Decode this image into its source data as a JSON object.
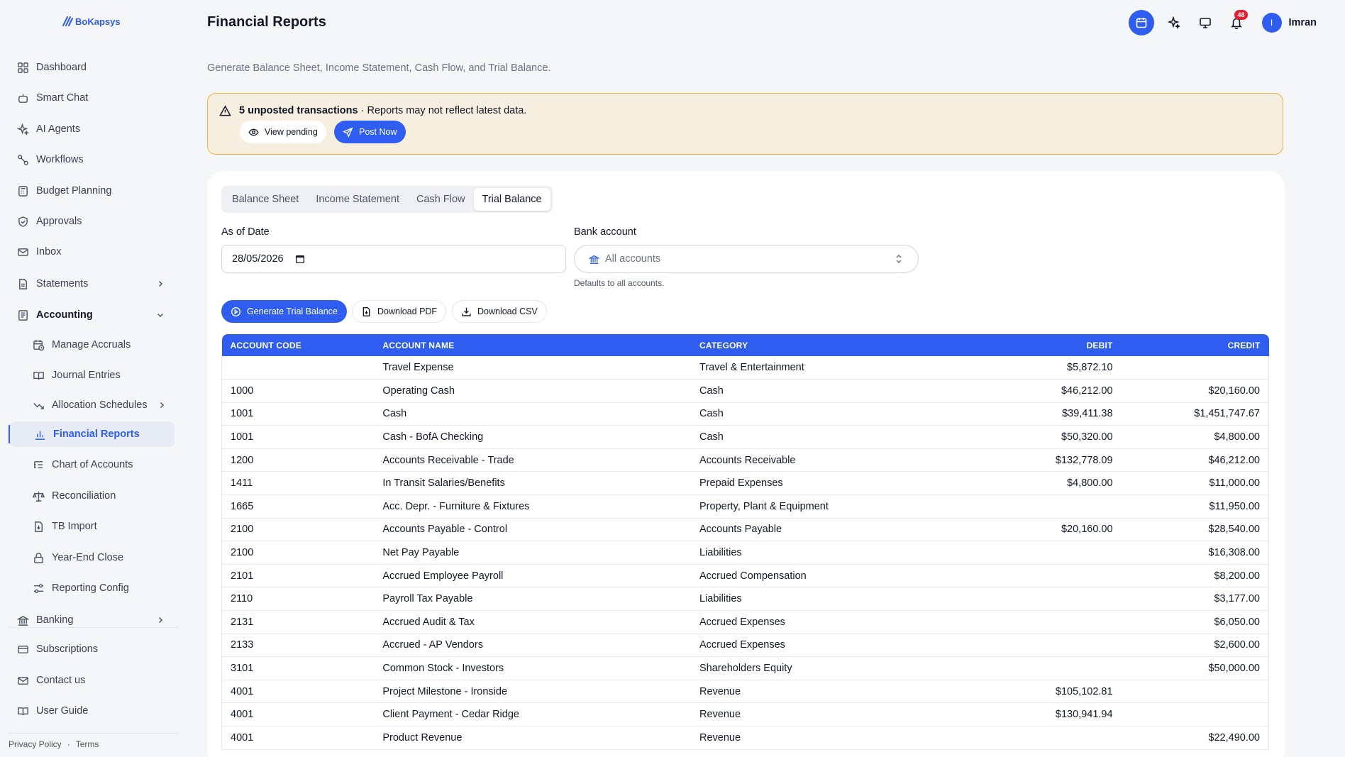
{
  "brand": {
    "name": "BoKapsys"
  },
  "sidebar": {
    "items": [
      {
        "label": "Dashboard",
        "icon": "grid-icon"
      },
      {
        "label": "Smart Chat",
        "icon": "bot-icon"
      },
      {
        "label": "AI Agents",
        "icon": "sparkles-icon"
      },
      {
        "label": "Workflows",
        "icon": "workflow-icon"
      },
      {
        "label": "Budget Planning",
        "icon": "calculator-icon"
      },
      {
        "label": "Approvals",
        "icon": "shield-check-icon"
      },
      {
        "label": "Inbox",
        "icon": "mail-icon"
      },
      {
        "label": "Statements",
        "icon": "file-icon"
      },
      {
        "label": "Accounting",
        "icon": "ledger-icon"
      }
    ],
    "accounting_sub": [
      {
        "label": "Manage Accruals",
        "icon": "calendar-clock-icon"
      },
      {
        "label": "Journal Entries",
        "icon": "book-open-icon"
      },
      {
        "label": "Allocation Schedules",
        "icon": "trend-down-icon"
      },
      {
        "label": "Financial Reports",
        "icon": "bar-chart-icon"
      },
      {
        "label": "Chart of Accounts",
        "icon": "list-tree-icon"
      },
      {
        "label": "Reconciliation",
        "icon": "scale-icon"
      },
      {
        "label": "TB Import",
        "icon": "file-import-icon"
      },
      {
        "label": "Year-End Close",
        "icon": "lock-icon"
      },
      {
        "label": "Reporting Config",
        "icon": "sliders-icon"
      }
    ],
    "bottom": [
      {
        "label": "Banking",
        "icon": "bank-icon"
      },
      {
        "label": "Subscriptions",
        "icon": "credit-card-icon"
      },
      {
        "label": "Contact us",
        "icon": "mail-icon"
      },
      {
        "label": "User Guide",
        "icon": "book-open-icon"
      }
    ],
    "footer": {
      "privacy": "Privacy Policy",
      "sep": "·",
      "terms": "Terms"
    }
  },
  "header": {
    "title": "Financial Reports",
    "subtitle": "Generate Balance Sheet, Income Statement, Cash Flow, and Trial Balance.",
    "notifications_count": "48",
    "user_initial": "I",
    "user_name": "Imran"
  },
  "alert": {
    "count_text": "5 unposted transactions",
    "message": " · Reports may not reflect latest data.",
    "view_label": "View pending",
    "post_label": "Post Now"
  },
  "tabs": [
    "Balance Sheet",
    "Income Statement",
    "Cash Flow",
    "Trial Balance"
  ],
  "active_tab": "Trial Balance",
  "form": {
    "date_label": "As of Date",
    "date_value": "28/05/2026",
    "bank_label": "Bank account",
    "bank_value": "All accounts",
    "bank_hint": "Defaults to all accounts."
  },
  "actions": {
    "generate": "Generate Trial Balance",
    "pdf": "Download PDF",
    "csv": "Download CSV"
  },
  "table": {
    "headers": [
      "ACCOUNT CODE",
      "ACCOUNT NAME",
      "CATEGORY",
      "DEBIT",
      "CREDIT"
    ],
    "rows": [
      [
        "",
        "Travel Expense",
        "Travel & Entertainment",
        "$5,872.10",
        ""
      ],
      [
        "1000",
        "Operating Cash",
        "Cash",
        "$46,212.00",
        "$20,160.00"
      ],
      [
        "1001",
        "Cash",
        "Cash",
        "$39,411.38",
        "$1,451,747.67"
      ],
      [
        "1001",
        "Cash - BofA Checking",
        "Cash",
        "$50,320.00",
        "$4,800.00"
      ],
      [
        "1200",
        "Accounts Receivable - Trade",
        "Accounts Receivable",
        "$132,778.09",
        "$46,212.00"
      ],
      [
        "1411",
        "In Transit Salaries/Benefits",
        "Prepaid Expenses",
        "$4,800.00",
        "$11,000.00"
      ],
      [
        "1665",
        "Acc. Depr. - Furniture & Fixtures",
        "Property, Plant & Equipment",
        "",
        "$11,950.00"
      ],
      [
        "2100",
        "Accounts Payable - Control",
        "Accounts Payable",
        "$20,160.00",
        "$28,540.00"
      ],
      [
        "2100",
        "Net Pay Payable",
        "Liabilities",
        "",
        "$16,308.00"
      ],
      [
        "2101",
        "Accrued Employee Payroll",
        "Accrued Compensation",
        "",
        "$8,200.00"
      ],
      [
        "2110",
        "Payroll Tax Payable",
        "Liabilities",
        "",
        "$3,177.00"
      ],
      [
        "2131",
        "Accrued Audit & Tax",
        "Accrued Expenses",
        "",
        "$6,050.00"
      ],
      [
        "2133",
        "Accrued - AP Vendors",
        "Accrued Expenses",
        "",
        "$2,600.00"
      ],
      [
        "3101",
        "Common Stock - Investors",
        "Shareholders Equity",
        "",
        "$50,000.00"
      ],
      [
        "4001",
        "Project Milestone - Ironside",
        "Revenue",
        "$105,102.81",
        ""
      ],
      [
        "4001",
        "Client Payment - Cedar Ridge",
        "Revenue",
        "$130,941.94",
        ""
      ],
      [
        "4001",
        "Product Revenue",
        "Revenue",
        "",
        "$22,490.00"
      ]
    ]
  },
  "colors": {
    "accent": "#2f5df0",
    "alert_bg": "#f6eedf",
    "alert_border": "#f0b343",
    "badge": "#e11d2e"
  }
}
